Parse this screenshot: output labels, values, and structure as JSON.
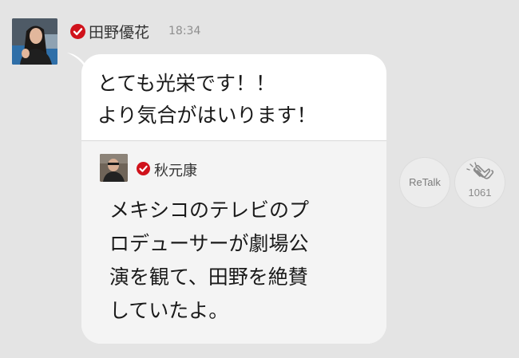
{
  "message": {
    "sender_name": "田野優花",
    "timestamp": "18:34",
    "text": "とても光栄です！！\nより気合がはいります！",
    "verified_badge_color": "#d0121b",
    "avatar_icon": "person-photo-icon"
  },
  "quoted_talk": {
    "author_name": "秋元康",
    "text": "メキシコのテレビのプ\nロデューサーが劇場公\n演を観て、田野を絶賛\nしていたよ。",
    "avatar_icon": "person-photo-icon"
  },
  "actions": {
    "retalk_label": "ReTalk",
    "applause_count": "1061",
    "applause_icon": "clapping-hands-icon"
  }
}
